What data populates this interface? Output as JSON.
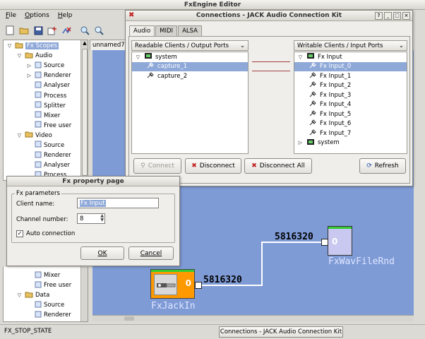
{
  "main": {
    "title": "FxEngine Editor",
    "menu": [
      "File",
      "Options",
      "Help"
    ],
    "tree": [
      {
        "label": "Fx Scopes",
        "depth": 0,
        "twisty": "open",
        "icon": "folder"
      },
      {
        "label": "Audio",
        "depth": 1,
        "twisty": "open",
        "icon": "folder"
      },
      {
        "label": "Source",
        "depth": 2,
        "twisty": "closed",
        "icon": "leaf"
      },
      {
        "label": "Renderer",
        "depth": 2,
        "twisty": "closed",
        "icon": "leaf"
      },
      {
        "label": "Analyser",
        "depth": 2,
        "twisty": "",
        "icon": "leaf"
      },
      {
        "label": "Process",
        "depth": 2,
        "twisty": "",
        "icon": "leaf"
      },
      {
        "label": "Splitter",
        "depth": 2,
        "twisty": "",
        "icon": "leaf"
      },
      {
        "label": "Mixer",
        "depth": 2,
        "twisty": "",
        "icon": "leaf"
      },
      {
        "label": "Free user",
        "depth": 2,
        "twisty": "",
        "icon": "leaf"
      },
      {
        "label": "Video",
        "depth": 1,
        "twisty": "open",
        "icon": "folder"
      },
      {
        "label": "Source",
        "depth": 2,
        "twisty": "",
        "icon": "leaf"
      },
      {
        "label": "Renderer",
        "depth": 2,
        "twisty": "",
        "icon": "leaf"
      },
      {
        "label": "Analyser",
        "depth": 2,
        "twisty": "",
        "icon": "leaf"
      },
      {
        "label": "Process",
        "depth": 2,
        "twisty": "",
        "icon": "leaf"
      }
    ],
    "tree_bottom": [
      {
        "label": "Mixer",
        "depth": 2,
        "twisty": "",
        "icon": "leaf"
      },
      {
        "label": "Free user",
        "depth": 2,
        "twisty": "",
        "icon": "leaf"
      },
      {
        "label": "Data",
        "depth": 1,
        "twisty": "open",
        "icon": "folder"
      },
      {
        "label": "Source",
        "depth": 2,
        "twisty": "",
        "icon": "leaf"
      },
      {
        "label": "Renderer",
        "depth": 2,
        "twisty": "",
        "icon": "leaf"
      }
    ],
    "doc_tab": "unnamed7",
    "status": "FX_STOP_STATE",
    "taskbar_item": "Connections - JACK Audio Connection Kit"
  },
  "canvas": {
    "node1": {
      "label": "FxJackIn",
      "value": "0",
      "link_value": "5816320"
    },
    "node2": {
      "label": "FxWavFileRnd",
      "value": "0",
      "link_value": "5816320"
    },
    "colors": {
      "canvas": "#7f9bd6",
      "node_orange": "#ff9900",
      "node_lavender": "#c8c8f0"
    }
  },
  "connections": {
    "title": "Connections - JACK Audio Connection Kit",
    "tabs": [
      "Audio",
      "MIDI",
      "ALSA"
    ],
    "active_tab": "Audio",
    "readable_header": "Readable Clients / Output Ports",
    "writable_header": "Writable Clients / Input Ports",
    "readable": [
      {
        "label": "system",
        "kind": "client"
      },
      {
        "label": "capture_1",
        "kind": "port",
        "selected": true
      },
      {
        "label": "capture_2",
        "kind": "port"
      }
    ],
    "writable": [
      {
        "label": "Fx Input",
        "kind": "client"
      },
      {
        "label": "Fx Input_0",
        "kind": "port",
        "selected": true
      },
      {
        "label": "Fx Input_1",
        "kind": "port"
      },
      {
        "label": "Fx Input_2",
        "kind": "port"
      },
      {
        "label": "Fx Input_3",
        "kind": "port"
      },
      {
        "label": "Fx Input_4",
        "kind": "port"
      },
      {
        "label": "Fx Input_5",
        "kind": "port"
      },
      {
        "label": "Fx Input_6",
        "kind": "port"
      },
      {
        "label": "Fx Input_7",
        "kind": "port"
      },
      {
        "label": "system",
        "kind": "client-collapsed"
      }
    ],
    "buttons": {
      "connect": "Connect",
      "disconnect": "Disconnect",
      "disconnect_all": "Disconnect All",
      "refresh": "Refresh"
    }
  },
  "property": {
    "title": "Fx property page",
    "group": "Fx parameters",
    "client_name_label": "Client name:",
    "client_name_value": "Fx Input",
    "channel_label": "Channel number:",
    "channel_value": "8",
    "auto_label": "Auto connection",
    "auto_checked": true,
    "ok": "OK",
    "cancel": "Cancel"
  }
}
